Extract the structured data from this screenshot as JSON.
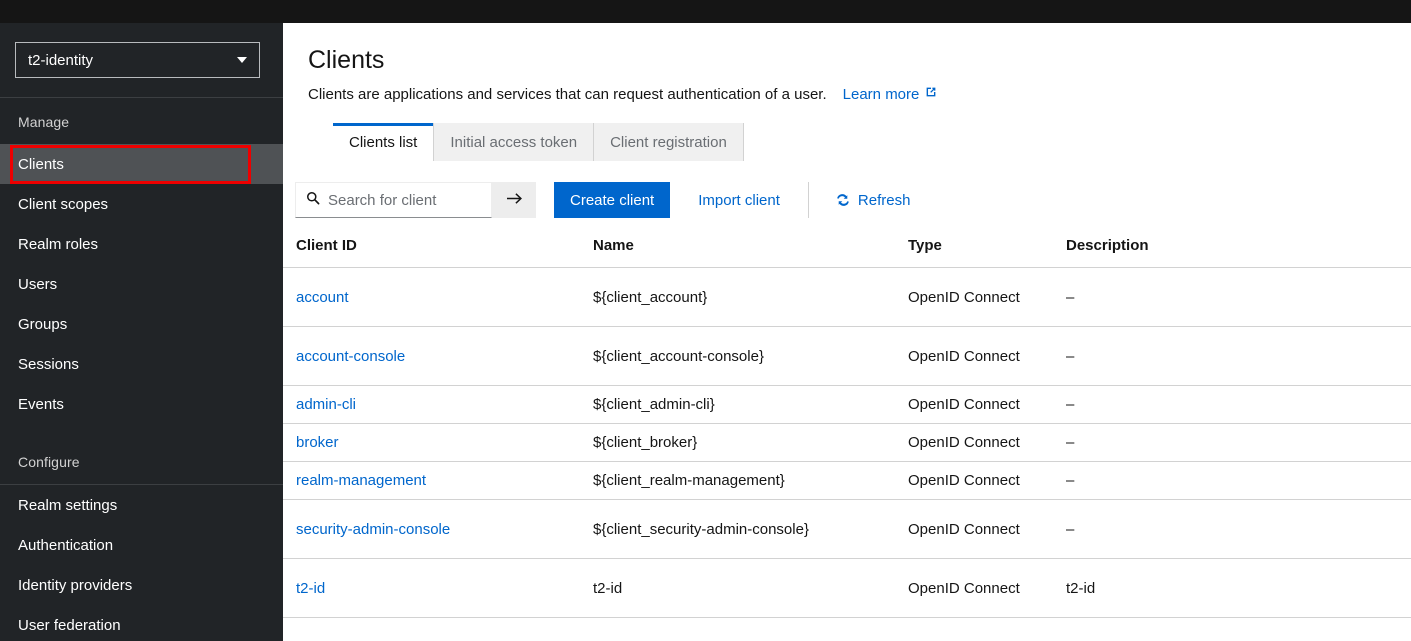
{
  "masthead": {
    "present": true
  },
  "sidebar": {
    "realm_selector": {
      "value": "t2-identity",
      "caret_icon": "chevron-down-icon"
    },
    "groups": [
      {
        "title": "Manage",
        "items": [
          {
            "label": "Clients",
            "active": true
          },
          {
            "label": "Client scopes",
            "active": false
          },
          {
            "label": "Realm roles",
            "active": false
          },
          {
            "label": "Users",
            "active": false
          },
          {
            "label": "Groups",
            "active": false
          },
          {
            "label": "Sessions",
            "active": false
          },
          {
            "label": "Events",
            "active": false
          }
        ]
      },
      {
        "title": "Configure",
        "items": [
          {
            "label": "Realm settings",
            "active": false
          },
          {
            "label": "Authentication",
            "active": false
          },
          {
            "label": "Identity providers",
            "active": false
          },
          {
            "label": "User federation",
            "active": false
          }
        ]
      }
    ],
    "highlight_color": "#ee0000"
  },
  "page": {
    "title": "Clients",
    "subtitle": "Clients are applications and services that can request authentication of a user.",
    "learn_more_label": "Learn more",
    "learn_more_icon": "external-link-icon"
  },
  "tabs": [
    {
      "label": "Clients list",
      "active": true
    },
    {
      "label": "Initial access token",
      "active": false
    },
    {
      "label": "Client registration",
      "active": false
    }
  ],
  "toolbar": {
    "search_placeholder": "Search for client",
    "search_value": "",
    "search_icon": "search-icon",
    "search_submit_icon": "arrow-right-icon",
    "create_client_label": "Create client",
    "import_client_label": "Import client",
    "refresh_label": "Refresh",
    "refresh_icon": "sync-icon",
    "accent_color": "#0066cc"
  },
  "table": {
    "columns": [
      "Client ID",
      "Name",
      "Type",
      "Description"
    ],
    "rows": [
      {
        "id": "account",
        "name": "${client_account}",
        "type": "OpenID Connect",
        "description": "–",
        "size": "tall"
      },
      {
        "id": "account-console",
        "name": "${client_account-console}",
        "type": "OpenID Connect",
        "description": "–",
        "size": "tall"
      },
      {
        "id": "admin-cli",
        "name": "${client_admin-cli}",
        "type": "OpenID Connect",
        "description": "–",
        "size": "short"
      },
      {
        "id": "broker",
        "name": "${client_broker}",
        "type": "OpenID Connect",
        "description": "–",
        "size": "short"
      },
      {
        "id": "realm-management",
        "name": "${client_realm-management}",
        "type": "OpenID Connect",
        "description": "–",
        "size": "short"
      },
      {
        "id": "security-admin-console",
        "name": "${client_security-admin-console}",
        "type": "OpenID Connect",
        "description": "–",
        "size": "tall"
      },
      {
        "id": "t2-id",
        "name": "t2-id",
        "type": "OpenID Connect",
        "description": "t2-id",
        "size": "tall"
      }
    ]
  }
}
